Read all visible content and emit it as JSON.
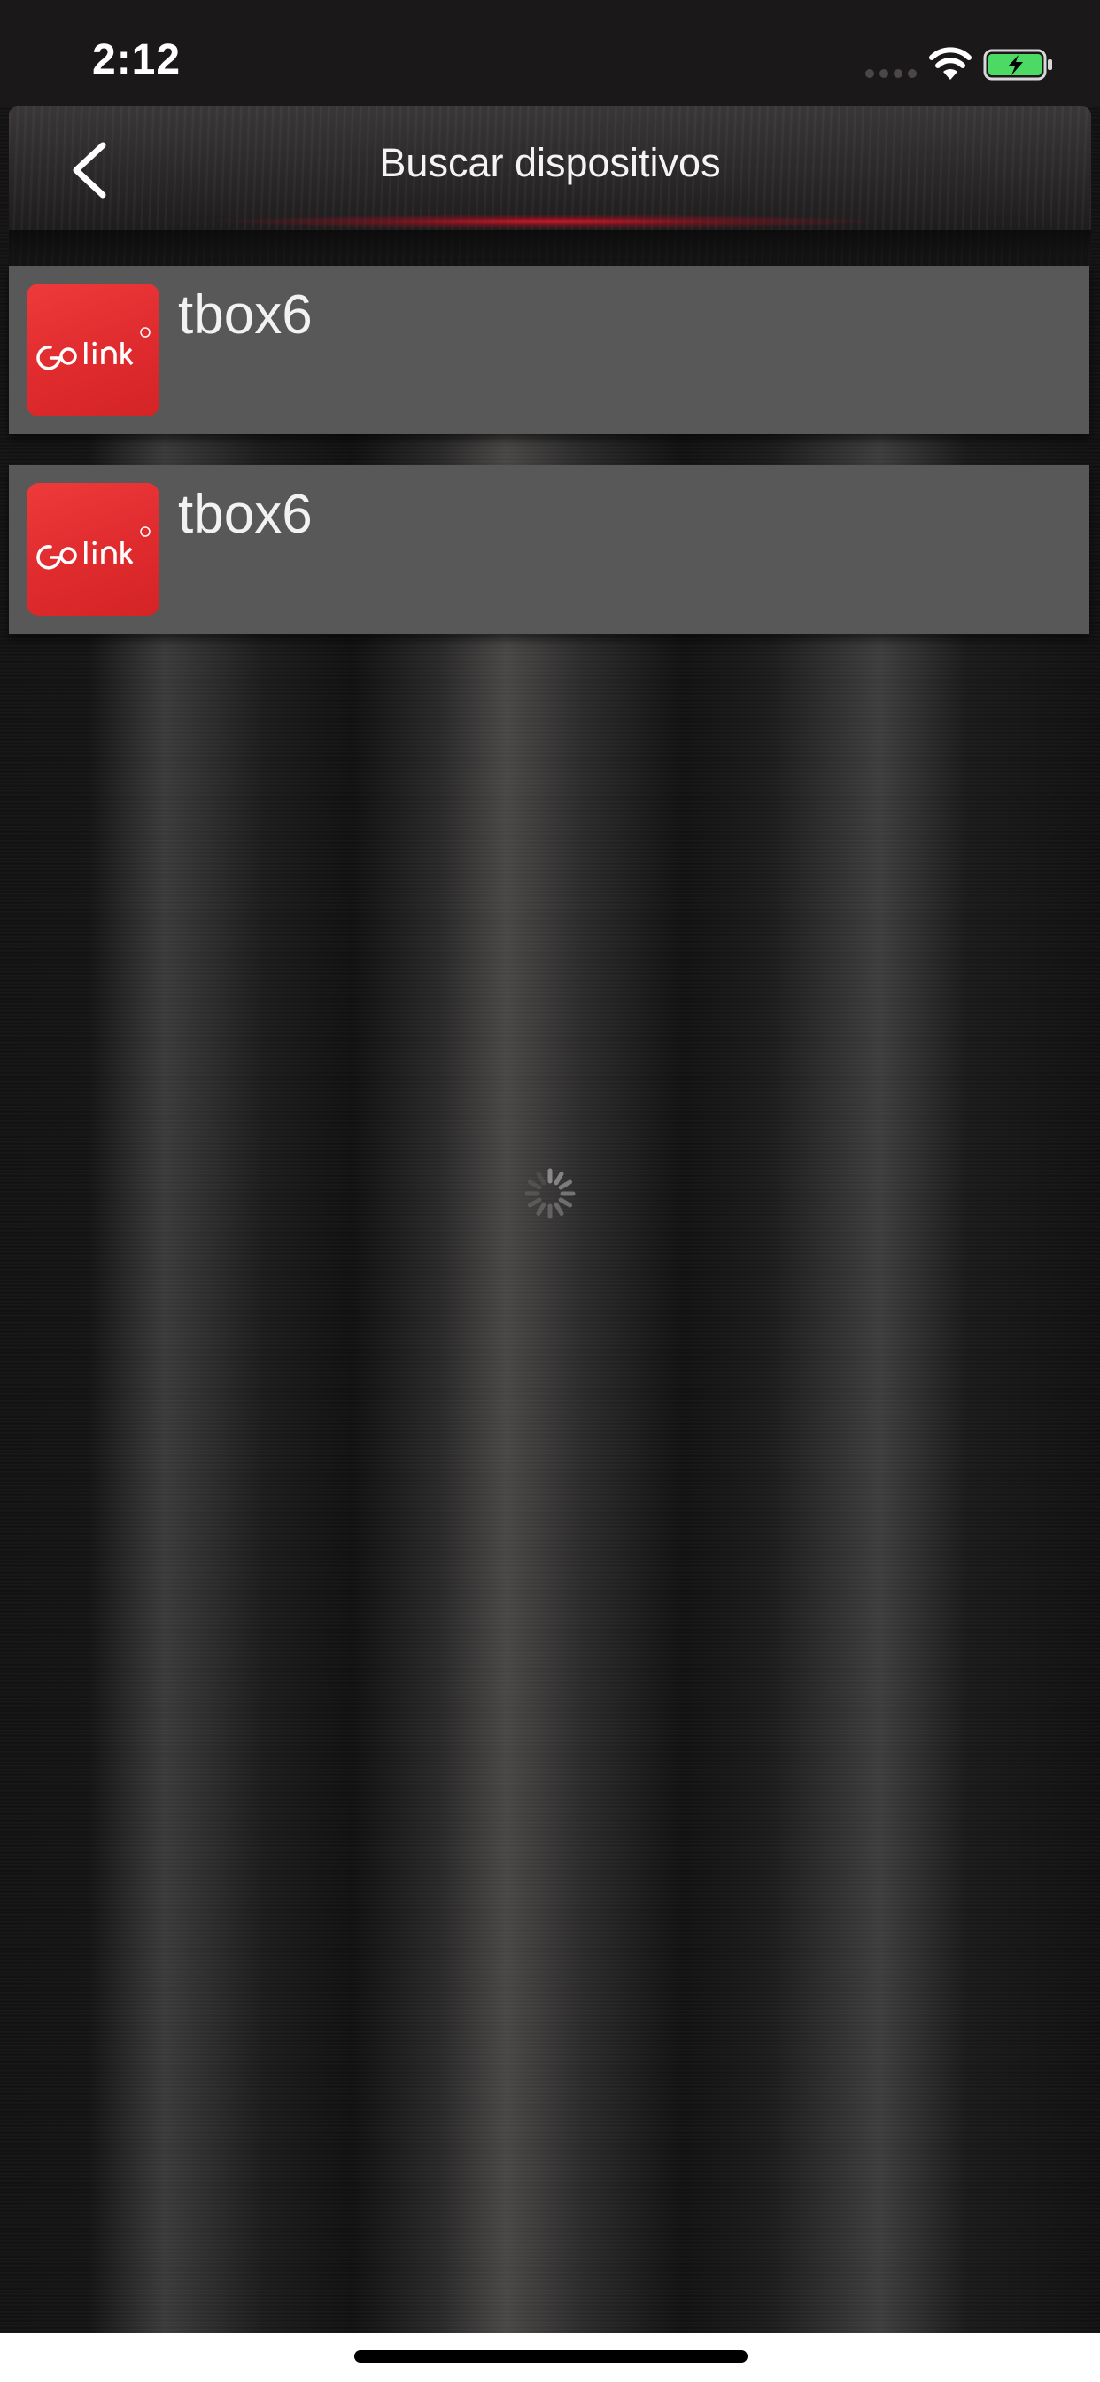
{
  "status_bar": {
    "time": "2:12",
    "signal_icon": "cellular-signal-icon",
    "wifi_icon": "wifi-icon",
    "battery_icon": "battery-charging-icon",
    "battery_color": "#4cd964"
  },
  "nav": {
    "back_icon": "chevron-left-icon",
    "title": "Buscar dispositivos",
    "accent_color": "#d71928"
  },
  "devices": [
    {
      "name": "tbox6",
      "logo_text": "Golink",
      "logo_color": "#e32b2e"
    },
    {
      "name": "tbox6",
      "logo_text": "Golink",
      "logo_color": "#e32b2e"
    }
  ],
  "loading": {
    "icon": "activity-spinner-icon"
  }
}
